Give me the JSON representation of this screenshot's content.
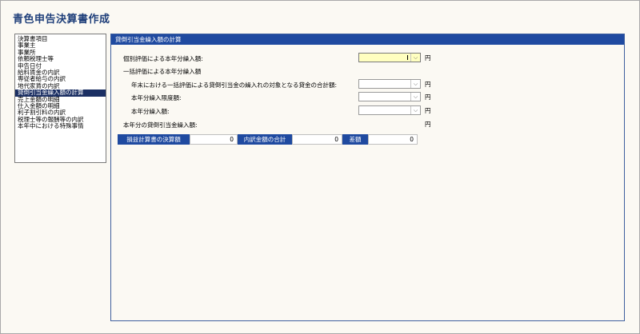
{
  "app": {
    "title": "青色申告決算書作成"
  },
  "nav": {
    "items": [
      "決算書項目",
      "事業主",
      "事業所",
      "依頼税理士等",
      "申告日付",
      "給料賃金の内訳",
      "専従者給与の内訳",
      "地代家賃の内訳",
      "貸倒引当金繰入額の計算",
      "売上金額の明細",
      "仕入金額の明細",
      "利子割引料の内訳",
      "税理士等の報酬等の内訳",
      "本年中における特殊事情"
    ],
    "selected_index": 8
  },
  "panel": {
    "title": "貸倒引当金繰入額の計算",
    "individual": {
      "label": "個別評価による本年分繰入額:",
      "value": "",
      "unit": "円"
    },
    "bulk_heading": "一括評価による本年分繰入額",
    "year_end_total": {
      "label": "年末における一括評価による貸倒引当金の繰入れの対象となる貸金の合計額:",
      "value": "",
      "unit": "円"
    },
    "limit": {
      "label": "本年分繰入限度額:",
      "value": "",
      "unit": "円"
    },
    "current": {
      "label": "本年分繰入額:",
      "value": "",
      "unit": "円"
    },
    "total": {
      "label": "本年分の貸倒引当金繰入額:",
      "unit": "円"
    },
    "summary": {
      "statement_label": "損益計算書の決算額",
      "statement_value": "0",
      "breakdown_label": "内訳金額の合計",
      "breakdown_value": "0",
      "diff_label": "差額",
      "diff_value": "0"
    }
  },
  "colors": {
    "accent": "#1f4aa0",
    "title_text": "#1f3f7a",
    "selected_nav": "#1b2f63",
    "active_field": "#ffffc0",
    "background": "#fbf9f3"
  },
  "icons": {
    "dropdown": "chevron-down-icon"
  }
}
